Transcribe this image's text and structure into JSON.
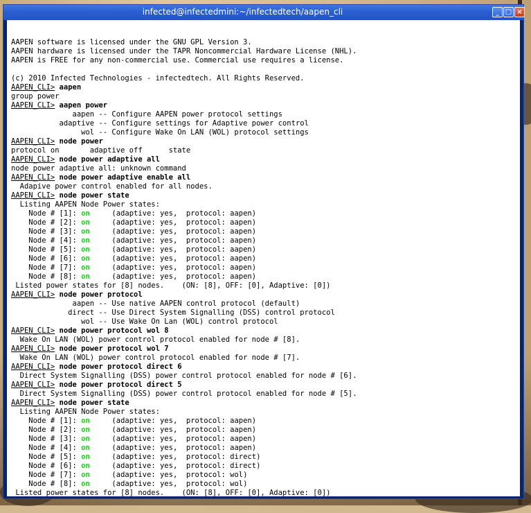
{
  "window": {
    "title": "infected@infectedmini:~/infectedtech/aapen_cli",
    "buttons": {
      "minimize": "_",
      "maximize": "□",
      "close": "×"
    }
  },
  "terminal": {
    "prompt": "AAPEN_CLI>",
    "lines": [
      {
        "t": "text",
        "v": ""
      },
      {
        "t": "text",
        "v": "AAPEN software is licensed under the GNU GPL Version 3."
      },
      {
        "t": "text",
        "v": "AAPEN hardware is licensed under the TAPR Noncommercial Hardware License (NHL)."
      },
      {
        "t": "text",
        "v": "AAPEN is FREE for any non-commercial use. Commercial use requires a license."
      },
      {
        "t": "text",
        "v": ""
      },
      {
        "t": "text",
        "v": "(c) 2010 Infected Technologies - infectedtech. All Rights Reserved."
      },
      {
        "t": "cmd",
        "v": "aapen"
      },
      {
        "t": "text",
        "v": "group power"
      },
      {
        "t": "cmd",
        "v": "aapen power"
      },
      {
        "t": "text",
        "v": "              aapen -- Configure AAPEN power protocol settings"
      },
      {
        "t": "text",
        "v": "           adaptive -- Configure settings for Adaptive power control"
      },
      {
        "t": "text",
        "v": "                wol -- Configure Wake On LAN (WOL) protocol settings"
      },
      {
        "t": "cmd",
        "v": "node power"
      },
      {
        "t": "text",
        "v": "protocol on       adaptive off      state"
      },
      {
        "t": "cmd",
        "v": "node power adaptive all"
      },
      {
        "t": "text",
        "v": "node power adaptive all: unknown command"
      },
      {
        "t": "cmd",
        "v": "node power adaptive enable all"
      },
      {
        "t": "text",
        "v": "  Adapive power control enabled for all nodes."
      },
      {
        "t": "cmd",
        "v": "node power state"
      },
      {
        "t": "text",
        "v": "  Listing AAPEN Node Power states:"
      },
      {
        "t": "node",
        "n": "1",
        "s": "on",
        "a": "yes",
        "p": "aapen"
      },
      {
        "t": "node",
        "n": "2",
        "s": "on",
        "a": "yes",
        "p": "aapen"
      },
      {
        "t": "node",
        "n": "3",
        "s": "on",
        "a": "yes",
        "p": "aapen"
      },
      {
        "t": "node",
        "n": "4",
        "s": "on",
        "a": "yes",
        "p": "aapen"
      },
      {
        "t": "node",
        "n": "5",
        "s": "on",
        "a": "yes",
        "p": "aapen"
      },
      {
        "t": "node",
        "n": "6",
        "s": "on",
        "a": "yes",
        "p": "aapen"
      },
      {
        "t": "node",
        "n": "7",
        "s": "on",
        "a": "yes",
        "p": "aapen"
      },
      {
        "t": "node",
        "n": "8",
        "s": "on",
        "a": "yes",
        "p": "aapen"
      },
      {
        "t": "text",
        "v": " Listed power states for [8] nodes.    (ON: [8], OFF: [0], Adaptive: [0])"
      },
      {
        "t": "cmd",
        "v": "node power protocol"
      },
      {
        "t": "text",
        "v": "              aapen -- Use native AAPEN control protocol (default)"
      },
      {
        "t": "text",
        "v": "             direct -- Use Direct System Signalling (DSS) control protocol"
      },
      {
        "t": "text",
        "v": "                wol -- Use Wake On Lan (WOL) control protocol"
      },
      {
        "t": "cmd",
        "v": "node power protocol wol 8"
      },
      {
        "t": "text",
        "v": "  Wake On LAN (WOL) power control protocol enabled for node # [8]."
      },
      {
        "t": "cmd",
        "v": "node power protocol wol 7"
      },
      {
        "t": "text",
        "v": "  Wake On LAN (WOL) power control protocol enabled for node # [7]."
      },
      {
        "t": "cmd",
        "v": "node power protocol direct 6"
      },
      {
        "t": "text",
        "v": "  Direct System Signalling (DSS) power control protocol enabled for node # [6]."
      },
      {
        "t": "cmd",
        "v": "node power protocol direct 5"
      },
      {
        "t": "text",
        "v": "  Direct System Signalling (DSS) power control protocol enabled for node # [5]."
      },
      {
        "t": "cmd",
        "v": "node power state"
      },
      {
        "t": "text",
        "v": "  Listing AAPEN Node Power states:"
      },
      {
        "t": "node",
        "n": "1",
        "s": "on",
        "a": "yes",
        "p": "aapen"
      },
      {
        "t": "node",
        "n": "2",
        "s": "on",
        "a": "yes",
        "p": "aapen"
      },
      {
        "t": "node",
        "n": "3",
        "s": "on",
        "a": "yes",
        "p": "aapen"
      },
      {
        "t": "node",
        "n": "4",
        "s": "on",
        "a": "yes",
        "p": "aapen"
      },
      {
        "t": "node",
        "n": "5",
        "s": "on",
        "a": "yes",
        "p": "direct"
      },
      {
        "t": "node",
        "n": "6",
        "s": "on",
        "a": "yes",
        "p": "direct"
      },
      {
        "t": "node",
        "n": "7",
        "s": "on",
        "a": "yes",
        "p": "wol"
      },
      {
        "t": "node",
        "n": "8",
        "s": "on",
        "a": "yes",
        "p": "wol"
      },
      {
        "t": "text",
        "v": " Listed power states for [8] nodes.    (ON: [8], OFF: [0], Adaptive: [0])"
      },
      {
        "t": "input",
        "v": ""
      }
    ]
  },
  "colors": {
    "titlebar": "#2b5fd1",
    "node_on": "#22cc22",
    "terminal_bg": "#ffffff",
    "terminal_fg": "#000000"
  }
}
